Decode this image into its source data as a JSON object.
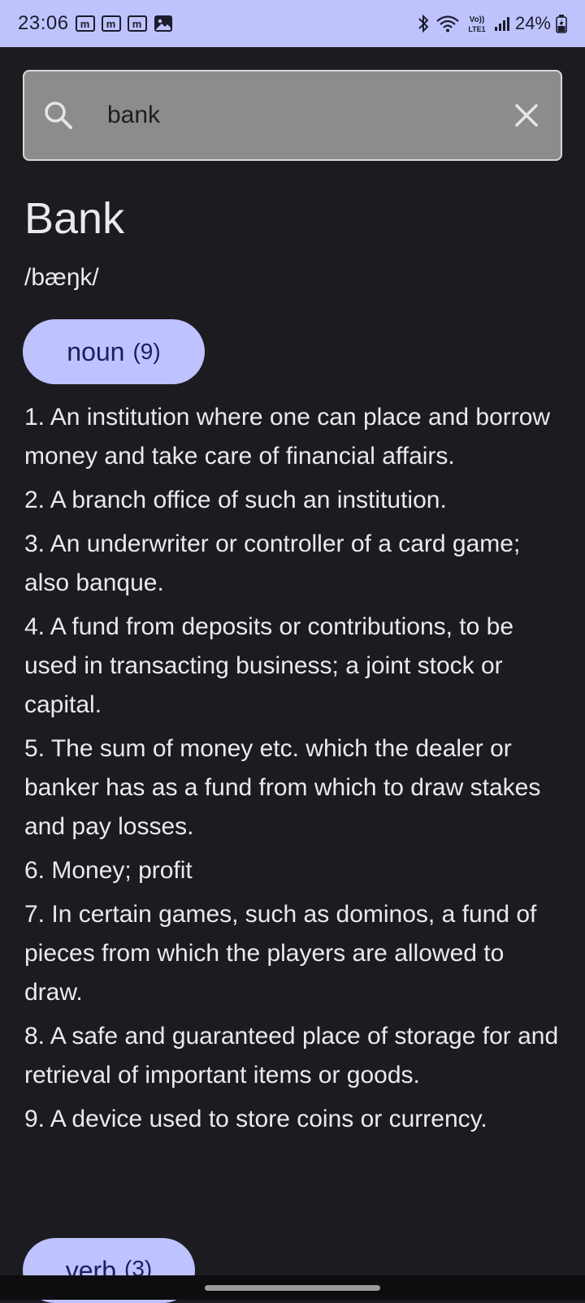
{
  "status_bar": {
    "time": "23:06",
    "notif_letter": "m",
    "battery": "24%",
    "icons": [
      "m-notification-icon",
      "m-notification-icon",
      "m-notification-icon",
      "gallery-icon",
      "bluetooth-icon",
      "wifi-icon",
      "volte-icon",
      "signal-icon",
      "battery-charging-icon"
    ]
  },
  "search": {
    "value": "bank",
    "placeholder": "",
    "icon": "search-icon",
    "clear_icon": "close-icon"
  },
  "entry": {
    "word": "Bank",
    "phonetic": "/bæŋk/",
    "parts_of_speech": [
      {
        "label": "noun",
        "count": "(9)",
        "definitions": [
          "1. An institution where one can place and borrow money and take care of financial affairs.",
          "2. A branch office of such an institution.",
          "3. An underwriter or controller of a card game; also banque.",
          "4. A fund from deposits or contributions, to be used in transacting business; a joint stock or capital.",
          "5. The sum of money etc. which the dealer or banker has as a fund from which to draw stakes and pay losses.",
          "6. Money; profit",
          "7. In certain games, such as dominos, a fund of pieces from which the players are allowed to draw.",
          "8. A safe and guaranteed place of storage for and retrieval of important items or goods.",
          "9. A device used to store coins or currency."
        ]
      },
      {
        "label": "verb",
        "count": "(3)"
      }
    ]
  },
  "colors": {
    "background": "#1c1b20",
    "status_bar": "#bfc3fd",
    "chip": "#bec2ff",
    "search_box": "#8c8c8c",
    "text": "#ece8ef"
  }
}
